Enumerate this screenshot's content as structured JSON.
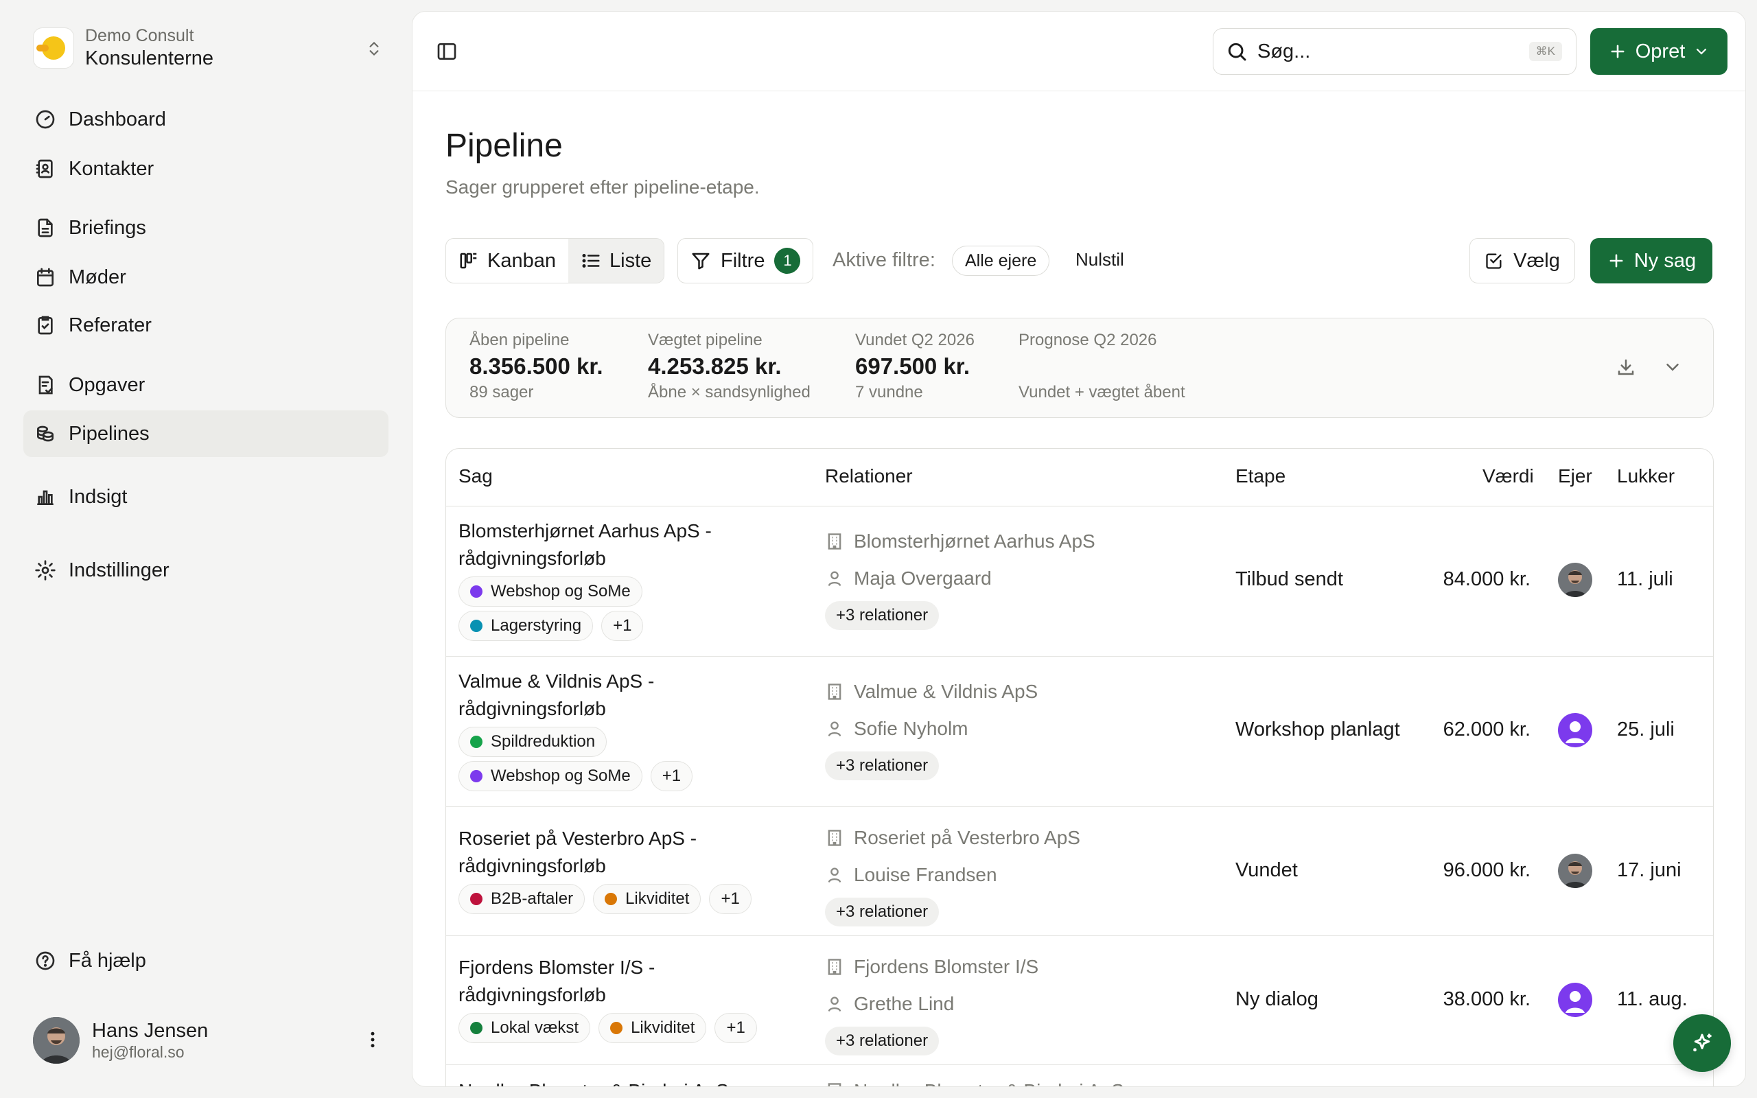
{
  "workspace": {
    "org": "Demo Consult",
    "name": "Konsulenterne"
  },
  "nav": {
    "dashboard": "Dashboard",
    "contacts": "Kontakter",
    "briefings": "Briefings",
    "meetings": "Møder",
    "minutes": "Referater",
    "tasks": "Opgaver",
    "pipelines": "Pipelines",
    "insights": "Indsigt",
    "settings": "Indstillinger",
    "help": "Få hjælp"
  },
  "user": {
    "name": "Hans Jensen",
    "email": "hej@floral.so"
  },
  "topbar": {
    "search_placeholder": "Søg...",
    "search_shortcut": "⌘K",
    "create_label": "Opret"
  },
  "page": {
    "title": "Pipeline",
    "subtitle": "Sager grupperet efter pipeline-etape."
  },
  "toolbar": {
    "kanban_label": "Kanban",
    "list_label": "Liste",
    "active_view": "Liste",
    "filter_label": "Filtre",
    "filter_count": "1",
    "active_filters_label": "Aktive filtre:",
    "owner_chip": "Alle ejere",
    "reset_label": "Nulstil",
    "select_label": "Vælg",
    "new_deal_label": "Ny sag"
  },
  "stats": [
    {
      "label": "Åben pipeline",
      "value": "8.356.500 kr.",
      "note": "89 sager"
    },
    {
      "label": "Vægtet pipeline",
      "value": "4.253.825 kr.",
      "note": "Åbne × sandsynlighed"
    },
    {
      "label": "Vundet Q2 2026",
      "value": "697.500 kr.",
      "note": "7 vundne"
    },
    {
      "label": "Prognose Q2 2026",
      "value": "",
      "note": "Vundet + vægtet åbent"
    }
  ],
  "table": {
    "headers": {
      "deal": "Sag",
      "relations": "Relationer",
      "stage": "Etape",
      "value": "Værdi",
      "owner": "Ejer",
      "close": "Lukker"
    },
    "rows": [
      {
        "title": "Blomsterhjørnet Aarhus ApS - rådgivningsforløb",
        "tags_line1": [
          {
            "label": "Webshop og SoMe",
            "color": "#7c3aed"
          }
        ],
        "tags_line2": [
          {
            "label": "Lagerstyring",
            "color": "#0891b2"
          }
        ],
        "more_tags": "+1",
        "company": "Blomsterhjørnet Aarhus ApS",
        "contact": "Maja Overgaard",
        "more_relations": "+3 relationer",
        "stage": "Tilbud sendt",
        "value": "84.000 kr.",
        "owner_avatar": "photo",
        "close": "11. juli"
      },
      {
        "title": "Valmue & Vildnis ApS - rådgivningsforløb",
        "tags_line1": [
          {
            "label": "Spildreduktion",
            "color": "#16a34a"
          }
        ],
        "tags_line2": [
          {
            "label": "Webshop og SoMe",
            "color": "#7c3aed"
          }
        ],
        "more_tags": "+1",
        "company": "Valmue & Vildnis ApS",
        "contact": "Sofie Nyholm",
        "more_relations": "+3 relationer",
        "stage": "Workshop planlagt",
        "value": "62.000 kr.",
        "owner_avatar": "purple",
        "close": "25. juli"
      },
      {
        "title": "Roseriet på Vesterbro ApS - rådgivningsforløb",
        "tags_line1": [
          {
            "label": "B2B-aftaler",
            "color": "#be123c"
          },
          {
            "label": "Likviditet",
            "color": "#d97706"
          }
        ],
        "more_tags": "+1",
        "company": "Roseriet på Vesterbro ApS",
        "contact": "Louise Frandsen",
        "more_relations": "+3 relationer",
        "stage": "Vundet",
        "value": "96.000 kr.",
        "owner_avatar": "photo",
        "close": "17. juni"
      },
      {
        "title": "Fjordens Blomster I/S - rådgivningsforløb",
        "tags_line1": [
          {
            "label": "Lokal vækst",
            "color": "#15803d"
          },
          {
            "label": "Likviditet",
            "color": "#d97706"
          }
        ],
        "more_tags": "+1",
        "company": "Fjordens Blomster I/S",
        "contact": "Grethe Lind",
        "more_relations": "+3 relationer",
        "stage": "Ny dialog",
        "value": "38.000 kr.",
        "owner_avatar": "purple",
        "close": "11. aug."
      },
      {
        "title": "Nordlys Blomster & Binderi ApS -",
        "company": "Nordlys Blomster & Binderi ApS"
      }
    ]
  },
  "colors": {
    "brand": "#176c38",
    "purple_avatar": "#7c3aed"
  }
}
